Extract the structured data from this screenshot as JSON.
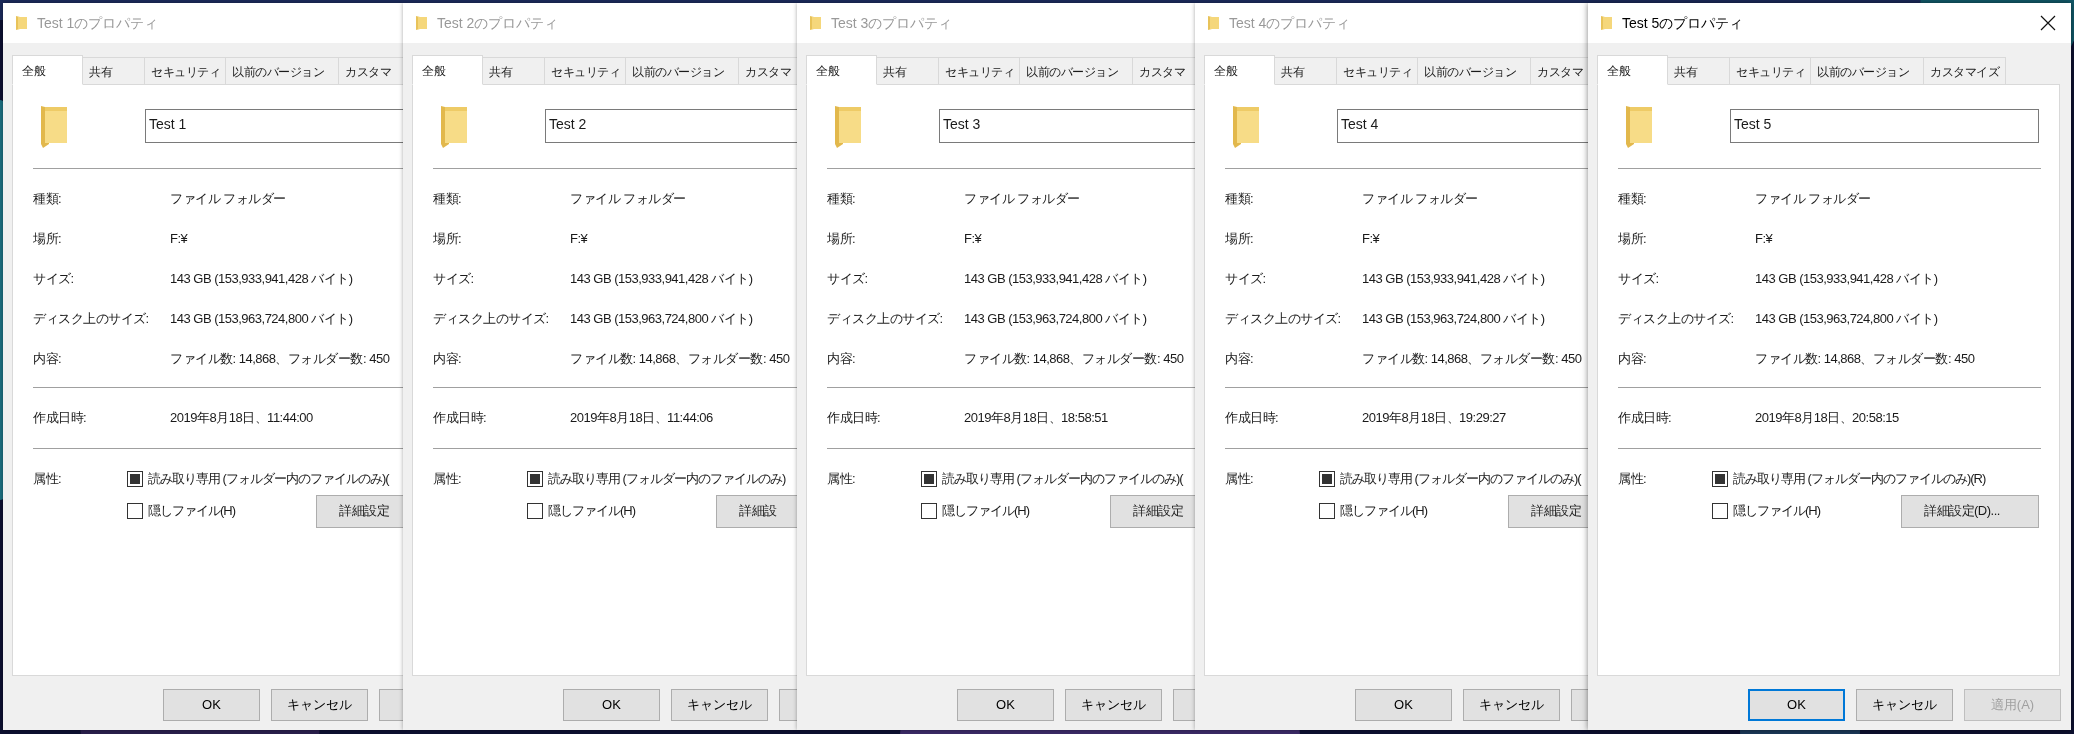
{
  "windows": [
    {
      "title": "Test 1のプロパティ",
      "active": false,
      "cut": true,
      "tabs": [
        {
          "label": "全般",
          "selected": true
        },
        {
          "label": "共有",
          "selected": false
        },
        {
          "label": "セキュリティ",
          "selected": false
        },
        {
          "label": "以前のバージョン",
          "selected": false
        },
        {
          "label": "カスタマ",
          "selected": false
        }
      ],
      "name_field": {
        "value": "Test 1"
      },
      "properties": [
        {
          "label": "種類:",
          "value": "ファイル フォルダー"
        },
        {
          "label": "場所:",
          "value": "F:¥"
        },
        {
          "label": "サイズ:",
          "value": "143 GB (153,933,941,428 バイト)"
        },
        {
          "label": "ディスク上のサイズ:",
          "value": "143 GB (153,963,724,800 バイト)"
        },
        {
          "label": "内容:",
          "value": "ファイル数: 14,868、フォルダー数: 450"
        }
      ],
      "created": {
        "label": "作成日時:",
        "value": "2019年8月18日、11:44:00"
      },
      "attributes": {
        "label": "属性:",
        "options": [
          {
            "label": "読み取り専用 (フォルダー内のファイルのみ)(",
            "checked": false,
            "indeterminate": true
          },
          {
            "label": "隠しファイル(H)",
            "checked": false,
            "indeterminate": false
          }
        ]
      },
      "advanced_button": "詳細設定",
      "buttons": [
        {
          "kind": "button",
          "label": "OK",
          "focused": false,
          "disabled": false
        },
        {
          "kind": "button",
          "label": "キャンセル",
          "focused": false,
          "disabled": false
        },
        {
          "kind": "stub"
        }
      ]
    },
    {
      "title": "Test 2のプロパティ",
      "active": false,
      "cut": true,
      "tabs": [
        {
          "label": "全般",
          "selected": true
        },
        {
          "label": "共有",
          "selected": false
        },
        {
          "label": "セキュリティ",
          "selected": false
        },
        {
          "label": "以前のバージョン",
          "selected": false
        },
        {
          "label": "カスタマ",
          "selected": false
        }
      ],
      "name_field": {
        "value": "Test 2"
      },
      "properties": [
        {
          "label": "種類:",
          "value": "ファイル フォルダー"
        },
        {
          "label": "場所:",
          "value": "F:¥"
        },
        {
          "label": "サイズ:",
          "value": "143 GB (153,933,941,428 バイト)"
        },
        {
          "label": "ディスク上のサイズ:",
          "value": "143 GB (153,963,724,800 バイト)"
        },
        {
          "label": "内容:",
          "value": "ファイル数: 14,868、フォルダー数: 450"
        }
      ],
      "created": {
        "label": "作成日時:",
        "value": "2019年8月18日、11:44:06"
      },
      "attributes": {
        "label": "属性:",
        "options": [
          {
            "label": "読み取り専用 (フォルダー内のファイルのみ)",
            "checked": false,
            "indeterminate": true
          },
          {
            "label": "隠しファイル(H)",
            "checked": false,
            "indeterminate": false
          }
        ]
      },
      "advanced_button": "詳細設",
      "buttons": [
        {
          "kind": "button",
          "label": "OK",
          "focused": false,
          "disabled": false
        },
        {
          "kind": "button",
          "label": "キャンセル",
          "focused": false,
          "disabled": false
        },
        {
          "kind": "stub"
        }
      ]
    },
    {
      "title": "Test 3のプロパティ",
      "active": false,
      "cut": true,
      "tabs": [
        {
          "label": "全般",
          "selected": true
        },
        {
          "label": "共有",
          "selected": false
        },
        {
          "label": "セキュリティ",
          "selected": false
        },
        {
          "label": "以前のバージョン",
          "selected": false
        },
        {
          "label": "カスタマ",
          "selected": false
        }
      ],
      "name_field": {
        "value": "Test 3"
      },
      "properties": [
        {
          "label": "種類:",
          "value": "ファイル フォルダー"
        },
        {
          "label": "場所:",
          "value": "F:¥"
        },
        {
          "label": "サイズ:",
          "value": "143 GB (153,933,941,428 バイト)"
        },
        {
          "label": "ディスク上のサイズ:",
          "value": "143 GB (153,963,724,800 バイト)"
        },
        {
          "label": "内容:",
          "value": "ファイル数: 14,868、フォルダー数: 450"
        }
      ],
      "created": {
        "label": "作成日時:",
        "value": "2019年8月18日、18:58:51"
      },
      "attributes": {
        "label": "属性:",
        "options": [
          {
            "label": "読み取り専用 (フォルダー内のファイルのみ)(",
            "checked": false,
            "indeterminate": true
          },
          {
            "label": "隠しファイル(H)",
            "checked": false,
            "indeterminate": false
          }
        ]
      },
      "advanced_button": "詳細設定",
      "buttons": [
        {
          "kind": "button",
          "label": "OK",
          "focused": false,
          "disabled": false
        },
        {
          "kind": "button",
          "label": "キャンセル",
          "focused": false,
          "disabled": false
        },
        {
          "kind": "stub"
        }
      ]
    },
    {
      "title": "Test 4のプロパティ",
      "active": false,
      "cut": true,
      "tabs": [
        {
          "label": "全般",
          "selected": true
        },
        {
          "label": "共有",
          "selected": false
        },
        {
          "label": "セキュリティ",
          "selected": false
        },
        {
          "label": "以前のバージョン",
          "selected": false
        },
        {
          "label": "カスタマ",
          "selected": false
        }
      ],
      "name_field": {
        "value": "Test 4"
      },
      "properties": [
        {
          "label": "種類:",
          "value": "ファイル フォルダー"
        },
        {
          "label": "場所:",
          "value": "F:¥"
        },
        {
          "label": "サイズ:",
          "value": "143 GB (153,933,941,428 バイト)"
        },
        {
          "label": "ディスク上のサイズ:",
          "value": "143 GB (153,963,724,800 バイト)"
        },
        {
          "label": "内容:",
          "value": "ファイル数: 14,868、フォルダー数: 450"
        }
      ],
      "created": {
        "label": "作成日時:",
        "value": "2019年8月18日、19:29:27"
      },
      "attributes": {
        "label": "属性:",
        "options": [
          {
            "label": "読み取り専用 (フォルダー内のファイルのみ)(",
            "checked": false,
            "indeterminate": true
          },
          {
            "label": "隠しファイル(H)",
            "checked": false,
            "indeterminate": false
          }
        ]
      },
      "advanced_button": "詳細設定",
      "buttons": [
        {
          "kind": "button",
          "label": "OK",
          "focused": false,
          "disabled": false
        },
        {
          "kind": "button",
          "label": "キャンセル",
          "focused": false,
          "disabled": false
        },
        {
          "kind": "stub"
        }
      ]
    },
    {
      "title": "Test 5のプロパティ",
      "active": true,
      "cut": false,
      "tabs": [
        {
          "label": "全般",
          "selected": true
        },
        {
          "label": "共有",
          "selected": false
        },
        {
          "label": "セキュリティ",
          "selected": false
        },
        {
          "label": "以前のバージョン",
          "selected": false
        },
        {
          "label": "カスタマイズ",
          "selected": false
        }
      ],
      "name_field": {
        "value": "Test 5"
      },
      "properties": [
        {
          "label": "種類:",
          "value": "ファイル フォルダー"
        },
        {
          "label": "場所:",
          "value": "F:¥"
        },
        {
          "label": "サイズ:",
          "value": "143 GB (153,933,941,428 バイト)"
        },
        {
          "label": "ディスク上のサイズ:",
          "value": "143 GB (153,963,724,800 バイト)"
        },
        {
          "label": "内容:",
          "value": "ファイル数: 14,868、フォルダー数: 450"
        }
      ],
      "created": {
        "label": "作成日時:",
        "value": "2019年8月18日、20:58:15"
      },
      "attributes": {
        "label": "属性:",
        "options": [
          {
            "label": "読み取り専用 (フォルダー内のファイルのみ)(R)",
            "checked": false,
            "indeterminate": true
          },
          {
            "label": "隠しファイル(H)",
            "checked": false,
            "indeterminate": false
          }
        ]
      },
      "advanced_button": "詳細設定(D)...",
      "buttons": [
        {
          "kind": "button",
          "label": "OK",
          "focused": true,
          "disabled": false
        },
        {
          "kind": "button",
          "label": "キャンセル",
          "focused": false,
          "disabled": false
        },
        {
          "kind": "button",
          "label": "適用(A)",
          "focused": false,
          "disabled": true
        }
      ]
    }
  ]
}
